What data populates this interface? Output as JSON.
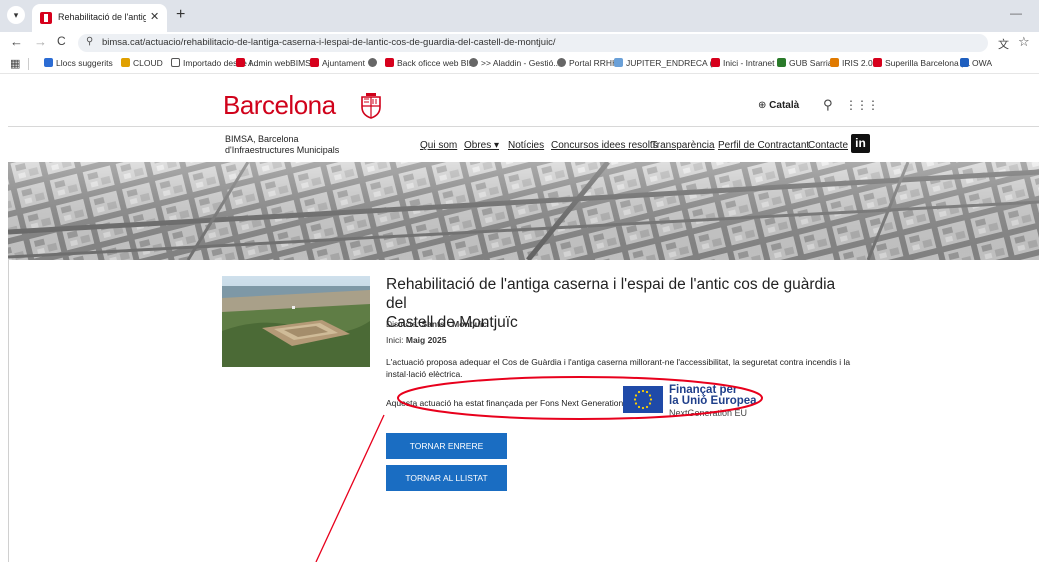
{
  "browser": {
    "tab_title": "Rehabilitació de l'antiga caserna",
    "tab_close": "✕",
    "new_tab": "+",
    "url": "bimsa.cat/actuacio/rehabilitacio-de-lantiga-caserna-i-lespai-de-lantic-cos-de-guardia-del-castell-de-montjuic/",
    "bookmarks": [
      {
        "label": "Llocs suggerits",
        "color": "#2b6cd4"
      },
      {
        "label": "CLOUD",
        "color": "#e0a000"
      },
      {
        "label": "Importado desde I...",
        "color": "#ffffff"
      },
      {
        "label": "Admin webBIMSA",
        "color": "#d6001c"
      },
      {
        "label": "Ajuntament",
        "color": "#d6001c"
      },
      {
        "label": "",
        "color": "#666666"
      },
      {
        "label": "Back oficce web BI...",
        "color": "#d6001c"
      },
      {
        "label": ">> Aladdin - Gestió...",
        "color": "#666666"
      },
      {
        "label": "Portal RRHH",
        "color": "#666666"
      },
      {
        "label": "JUPITER_ENDRECA (...",
        "color": "#6aa0d8"
      },
      {
        "label": "Inici - Intranet",
        "color": "#d6001c"
      },
      {
        "label": "GUB Sarria",
        "color": "#2a7a2a"
      },
      {
        "label": "IRIS 2.0:",
        "color": "#e07a00"
      },
      {
        "label": "Superilla Barcelona |...",
        "color": "#d6001c"
      },
      {
        "label": "OWA",
        "color": "#1f5fbf"
      }
    ]
  },
  "header": {
    "logo": "Barcelona",
    "language": "Català",
    "brand_line1": "BIMSA, Barcelona",
    "brand_line2": "d'Infraestructures Municipals",
    "menu": [
      "Qui som",
      "Obres ▾",
      "Notícies",
      "Concursos idees resolts",
      "Transparència",
      "Perfil de Contractant",
      "Contacte"
    ],
    "linkedin": "in"
  },
  "project": {
    "title_line1": "Rehabilitació de l'antiga caserna i l'espai de l'antic cos de guàrdia del",
    "title_line2": "Castell de Montjuïc",
    "district_label": "Districte:",
    "district_value": "Sants - Montjuïc",
    "start_label": "Inici:",
    "start_value": "Maig 2025",
    "description": "L'actuació proposa adequar el Cos de Guàrdia i l'antiga caserna millorant-ne l'accessibilitat, la seguretat contra incendis i la instal·lació elèctrica.",
    "funding_text": "Aquesta actuació ha estat finançada per Fons Next Generation",
    "eu_line1": "Finançat per",
    "eu_line2": "la Unió Europea",
    "eu_line3": "NextGeneration EU"
  },
  "buttons": {
    "back": "TORNAR ENRERE",
    "list": "TORNAR AL LLISTAT"
  },
  "colors": {
    "brand_red": "#d0021b",
    "button_blue": "#1a6dc2",
    "annotation_red": "#e8001c",
    "eu_blue": "#1f4aa8"
  }
}
